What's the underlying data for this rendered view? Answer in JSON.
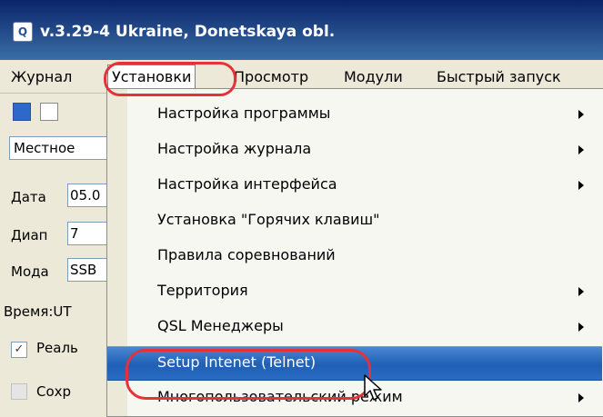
{
  "window": {
    "app_icon_glyph": "Q",
    "title": "v.3.29-4 Ukraine, Donetskaya obl."
  },
  "menubar": {
    "items": [
      "Журнал",
      "Установки",
      "Просмотр",
      "Модули",
      "Быстрый запуск"
    ],
    "active_index": 1
  },
  "toolbar": {
    "icons": [
      "save-icon",
      "new-document-icon"
    ]
  },
  "left_panel": {
    "combo_value": "Местное",
    "fields": [
      {
        "label": "Дата",
        "value": "05.0"
      },
      {
        "label": "Диап",
        "value": "7"
      },
      {
        "label": "Мода",
        "value": "SSB"
      }
    ],
    "time_label": "Время:UT",
    "checkboxes": [
      {
        "label": "Реаль",
        "checked": true,
        "enabled": true
      },
      {
        "label": "Сохр",
        "checked": false,
        "enabled": false
      }
    ]
  },
  "dropdown": {
    "items": [
      {
        "label": "Настройка программы",
        "submenu": true
      },
      {
        "label": "Настройка журнала",
        "submenu": true
      },
      {
        "label": "Настройка интерфейса",
        "submenu": true
      },
      {
        "label": "Установка \"Горячих клавиш\"",
        "submenu": false
      },
      {
        "label": "Правила соревнований",
        "submenu": false
      },
      {
        "label": "Территория",
        "submenu": true
      },
      {
        "label": "QSL Менеджеры",
        "submenu": true
      },
      {
        "label": "Setup Intenet (Telnet)",
        "submenu": false,
        "highlighted": true
      },
      {
        "label": "Многопользовательский режим",
        "submenu": true
      }
    ]
  },
  "colors": {
    "annotation_red": "#e5323a",
    "highlight_blue": "#2a6cc4",
    "titlebar_blue": "#0a246a"
  }
}
